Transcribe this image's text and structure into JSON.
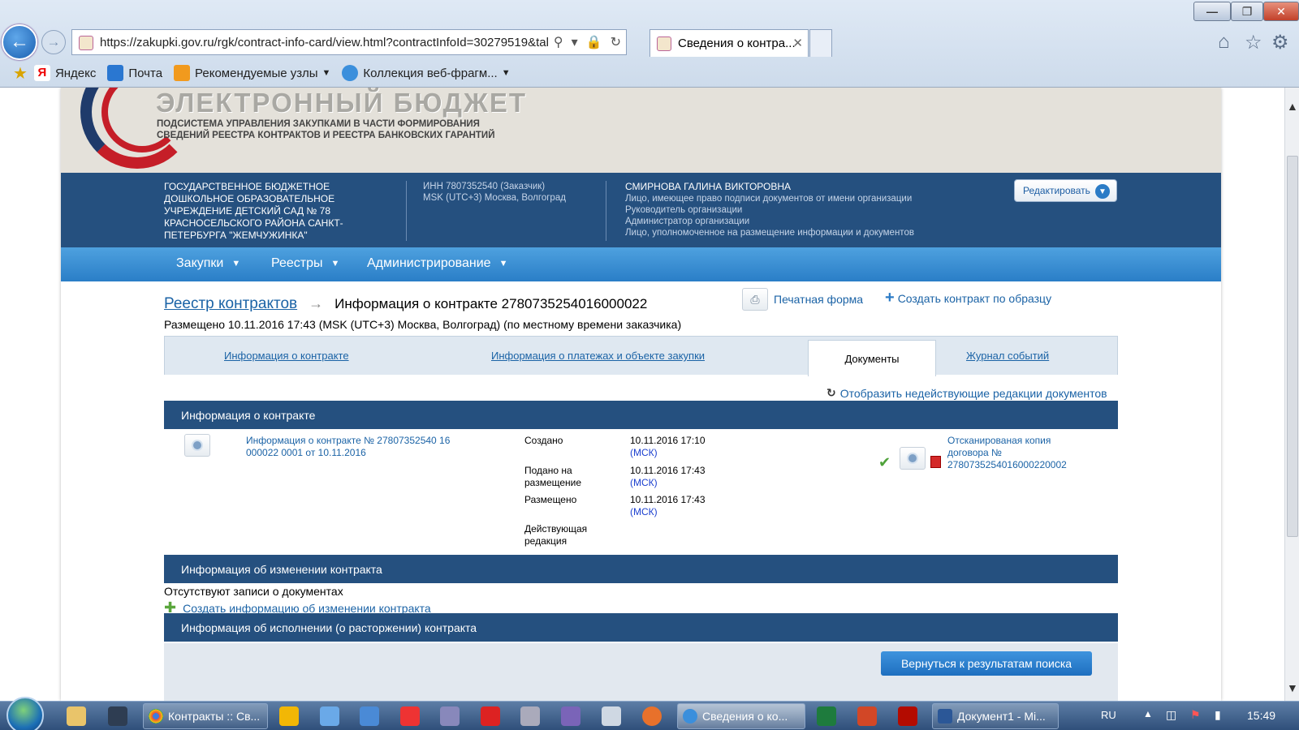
{
  "browser": {
    "url": "https://zakupki.gov.ru/rgk/contract-info-card/view.html?contractInfoId=30279519&tal",
    "tab_title": "Сведения о контра...",
    "favorites": [
      "Яндекс",
      "Почта",
      "Рекомендуемые узлы",
      "Коллекция веб-фрагм..."
    ]
  },
  "banner": {
    "title": "ЭЛЕКТРОННЫЙ БЮДЖЕТ",
    "subtitle": "ПОДСИСТЕМА УПРАВЛЕНИЯ ЗАКУПКАМИ В ЧАСТИ ФОРМИРОВАНИЯ СВЕДЕНИЙ РЕЕСТРА КОНТРАКТОВ И РЕЕСТРА БАНКОВСКИХ ГАРАНТИЙ"
  },
  "org": {
    "name": "ГОСУДАРСТВЕННОЕ БЮДЖЕТНОЕ ДОШКОЛЬНОЕ ОБРАЗОВАТЕЛЬНОЕ УЧРЕЖДЕНИЕ ДЕТСКИЙ САД № 78 КРАСНОСЕЛЬСКОГО РАЙОНА САНКТ-ПЕТЕРБУРГА \"ЖЕМЧУЖИНКА\"",
    "inn": "ИНН 7807352540 (Заказчик)",
    "timezone": "MSK (UTC+3) Москва, Волгоград",
    "person_name": "СМИРНОВА ГАЛИНА ВИКТОРОВНА",
    "roles": [
      "Лицо, имеющее право подписи документов от имени организации",
      "Руководитель организации",
      "Администратор организации",
      "Лицо, уполномоченное на размещение информации и документов"
    ],
    "edit_label": "Редактировать"
  },
  "menu": [
    "Закупки",
    "Реестры",
    "Администрирование"
  ],
  "breadcrumb": {
    "link": "Реестр контрактов",
    "current": "Информация о контракте 2780735254016000022"
  },
  "placed": "Размещено 10.11.2016 17:43 (MSK (UTC+3) Москва, Волгоград) (по местному времени заказчика)",
  "actions": {
    "print": "Печатная форма",
    "create_from_template": "Создать контракт по образцу"
  },
  "tabs": {
    "info": "Информация о контракте",
    "payments": "Информация о платежах и объекте закупки",
    "documents": "Документы",
    "journal": "Журнал событий"
  },
  "show_inactive": "Отобразить недействующие редакции документов",
  "section1": {
    "title": "Информация о контракте",
    "doc_link": "Информация о контракте № 27807352540 16 000022 0001 от 10.11.2016",
    "created_label": "Создано",
    "created_value": "10.11.2016 17:10",
    "submitted_label": "Подано на размещение",
    "submitted_value": "10.11.2016 17:43",
    "placed_label": "Размещено",
    "placed_value": "10.11.2016 17:43",
    "tz": "(МСК)",
    "current_label": "Действующая редакция",
    "scan_link": "Отсканированая копия договора № 2780735254016000220002"
  },
  "section2": {
    "title": "Информация об изменении контракта",
    "empty": "Отсутствуют записи о документах",
    "create_link": "Создать информацию об изменении контракта"
  },
  "section3": {
    "title": "Информация об исполнении (о расторжении) контракта"
  },
  "back_button": "Вернуться к результатам поиска",
  "taskbar": {
    "task1": "Контракты :: Св...",
    "task2": "Сведения о ко...",
    "task3": "Документ1 - Mi...",
    "lang": "RU",
    "time": "15:49"
  }
}
